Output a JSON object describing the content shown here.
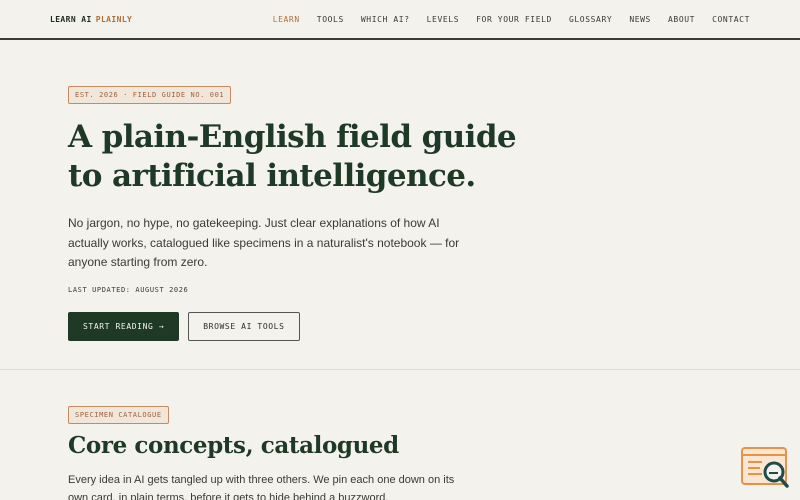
{
  "nav": {
    "brand": "LEARN AI",
    "brand_accent": "PLAINLY",
    "items": [
      {
        "label": "LEARN",
        "active": true
      },
      {
        "label": "TOOLS",
        "active": false
      },
      {
        "label": "WHICH AI?",
        "active": false
      },
      {
        "label": "LEVELS",
        "active": false
      },
      {
        "label": "FOR YOUR FIELD",
        "active": false
      },
      {
        "label": "GLOSSARY",
        "active": false
      },
      {
        "label": "NEWS",
        "active": false
      },
      {
        "label": "ABOUT",
        "active": false
      },
      {
        "label": "CONTACT",
        "active": false
      }
    ]
  },
  "hero": {
    "tag": "EST. 2026 · FIELD GUIDE NO. 001",
    "title": "A plain-English field guide to artificial intelligence.",
    "lead": "No jargon, no hype, no gatekeeping. Just clear explanations of how AI actually works, catalogued like specimens in a naturalist's notebook — for anyone starting from zero.",
    "updated": "LAST UPDATED: AUGUST 2026",
    "primary_button": "START READING →",
    "secondary_button": "BROWSE AI TOOLS"
  },
  "catalogue": {
    "tag": "SPECIMEN CATALOGUE",
    "title": "Core concepts, catalogued",
    "text": "Every idea in AI gets tangled up with three others. We pin each one down on its own card, in plain terms, before it gets to hide behind a buzzword."
  },
  "widget": {
    "icon": "search-document-icon"
  },
  "colors": {
    "background": "#f3f2ec",
    "accent": "#b0703a",
    "primary": "#1e3a26"
  }
}
